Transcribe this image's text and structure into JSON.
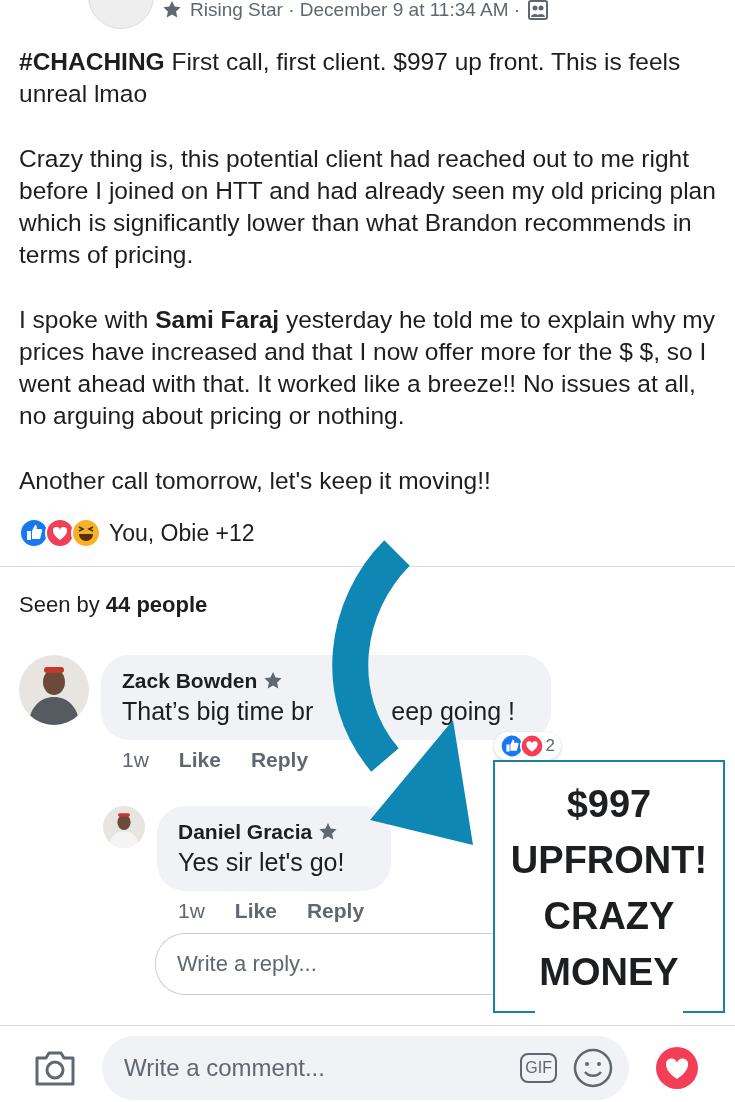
{
  "post": {
    "header": "Rising Star · December 9 at 11:34 AM ·",
    "paragraphs": [
      "**#CHACHING** First call, first client. $997 up front. This is feels unreal lmao",
      "Crazy thing is, this potential client had reached out to me right before I joined on HTT and had already seen my old pricing plan which is significantly lower than what Brandon recommends in terms of pricing.",
      "I spoke with **Sami Faraj** yesterday he told me to explain why my prices have increased and that I now offer more for the $ $, so I went ahead with that. It worked like a breeze!! No issues at all, no arguing about pricing or nothing.",
      "Another call tomorrow, let's keep it moving!!"
    ],
    "reactions": "You, Obie +12"
  },
  "seen_by": "Seen by **44 people**",
  "comments": [
    {
      "kind": "top",
      "author": "Zack Bowden",
      "text_parts": [
        "That’s big time br",
        "eep going !"
      ],
      "time": "1w",
      "actions": [
        "Like",
        "Reply"
      ],
      "reaction_count": "2"
    },
    {
      "kind": "reply",
      "author": "Daniel Gracia",
      "text_parts": [
        "Yes sir let's go!"
      ],
      "time": "1w",
      "actions": [
        "Like",
        "Reply"
      ]
    }
  ],
  "reply_field": {
    "placeholder": "Write a reply..."
  },
  "overlay": {
    "lines": [
      "$997",
      "UPFRONT!",
      "CRAZY",
      "MONEY"
    ]
  },
  "composer": {
    "placeholder": "Write a comment...",
    "gif": "GIF"
  }
}
